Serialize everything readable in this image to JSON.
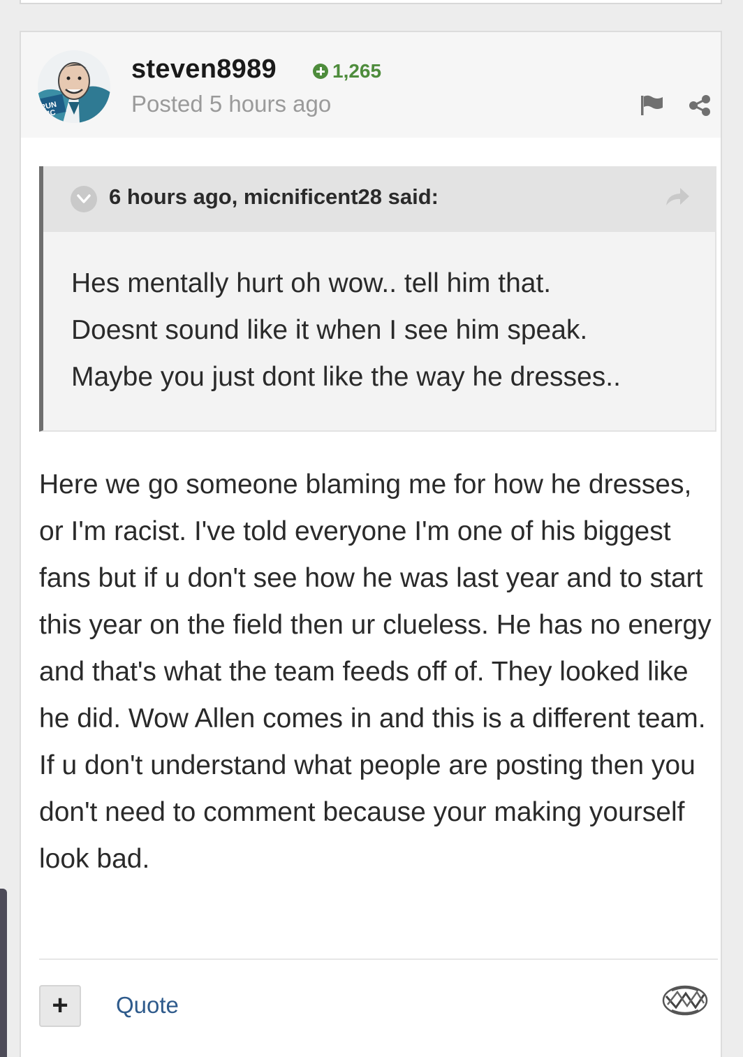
{
  "post": {
    "author": "steven8989",
    "reputation": "1,265",
    "posted_time": "Posted 5 hours ago",
    "quote": {
      "citation": "6 hours ago, micnificent28 said:",
      "lines": [
        "Hes mentally hurt oh wow.. tell him that.",
        "Doesnt sound like it when I see him speak.",
        "Maybe you just dont like the way he dresses.."
      ]
    },
    "body": "Here we go someone blaming me for how he dresses, or I'm racist. I've told everyone I'm one of his biggest fans but if u don't see how he was last year and to start this year on the field then ur clueless. He has no energy and that's what the team feeds off of. They looked like he did. Wow Allen comes in and this is a different team. If u don't understand what people are posting then you don't need to comment because your making yourself look bad.",
    "footer": {
      "plus_label": "+",
      "quote_label": "Quote"
    }
  },
  "avatar_badge_text": "RUN MC",
  "icons": {
    "rep": "plus-circle-icon",
    "report": "flag-icon",
    "share": "share-icon",
    "quote_toggle": "chevron-down-icon",
    "quote_jump": "arrow-forward-icon",
    "reaction": "reaction-icon"
  },
  "colors": {
    "reputation_green": "#4e8c3c",
    "link_blue": "#2f5b8c",
    "quote_border": "#6e6e6e"
  }
}
